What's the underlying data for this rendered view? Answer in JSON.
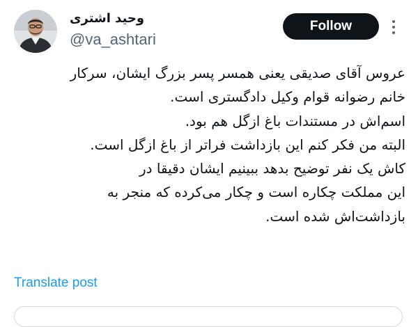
{
  "header": {
    "display_name": "وحید اشتری",
    "handle": "@va_ashtari",
    "follow_label": "Follow",
    "avatar_icon": "user-avatar-photo",
    "more_icon": "more-options-icon"
  },
  "tweet": {
    "lines": [
      "عروس آقای صدیقی یعنی همسر پسر بزرگ ایشان، سرکار",
      "خانم رضوانه قوام وکیل دادگستری است.",
      "اسم‌اش در مستندات باغ ازگل هم بود.",
      "البته من فکر کنم این بازداشت فراتر از باغ ازگل است.",
      "کاش یک نفر توضیح بدهد ببینیم ایشان دقیقا در",
      "این مملکت چکاره است و چکار می‌کرده که منجر به",
      "بازداشت‌اش شده است."
    ]
  },
  "footer": {
    "translate_label": "Translate post"
  },
  "colors": {
    "text": "#0f1419",
    "secondary": "#536471",
    "link": "#1d9bf0",
    "button_bg": "#0f1419",
    "border": "#cfd9de"
  }
}
